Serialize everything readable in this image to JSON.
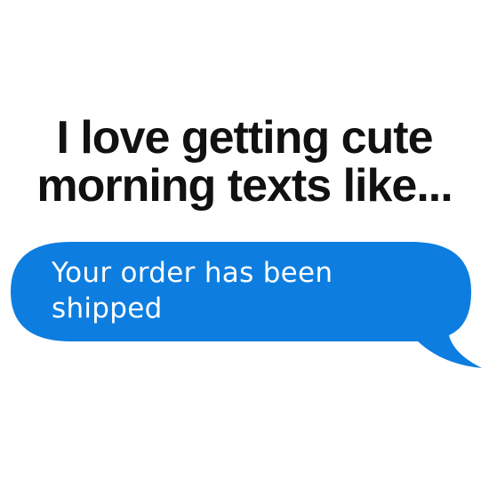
{
  "headline": {
    "line1": "I love getting cute",
    "line2": "morning texts like..."
  },
  "message": {
    "text": "Your order has been shipped",
    "bubble_color": "#0d7ee0",
    "text_color": "#ffffff"
  },
  "colors": {
    "background": "#ffffff",
    "headline": "#111111"
  }
}
